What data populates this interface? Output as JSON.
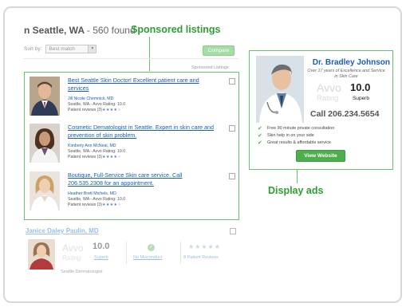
{
  "header": {
    "location": "n Seattle, WA",
    "count": "- 560 found"
  },
  "callouts": {
    "sponsored": "Sponsored listings",
    "display": "Display ads"
  },
  "sort": {
    "label": "Sort by:",
    "value": "Best match"
  },
  "compare_label": "Compare",
  "sponsored_tag": "Sponsored Listings",
  "listings": [
    {
      "title": "Best Seattle Skin Doctor! Excellent patient care and services",
      "name": "Jill Nicole Chemnick, MD",
      "location_rating": "Seattle, WA - Avvo Rating: 10.0",
      "reviews": "Patient reviews (3)",
      "stars_filled": 4
    },
    {
      "title": "Cosmetic Dematologist in Seattle. Expert in skin care and prevention of skin problem.",
      "name": "Kimberly Ann McNeal, MD",
      "location_rating": "Seattle, WA - Avvo Rating: 10.0",
      "reviews": "Patient reviews (3)",
      "stars_filled": 4
    },
    {
      "title": "Boutique, Full-Service Skin care service. Call 206.535.2308 for an appointment.",
      "name": "Heather Brett Michels, MD",
      "location_rating": "Seattle, WA - Avvo Rating: 10.0",
      "reviews": "Patient reviews (3)",
      "stars_filled": 4
    }
  ],
  "organic": {
    "name": "Janice Daley Paulin, MD",
    "avvo": "Avvo",
    "score": "10.0",
    "rating_word": "Rating",
    "superb": "Superb",
    "no_misconduct": "No Misconduct",
    "reviews": "8 Patient Reviews",
    "specialty": "Seattle Dermatologist"
  },
  "ad": {
    "name": "Dr. Bradley Johnson",
    "tagline": "Over 17 years of Excellence and Service in Skin Care",
    "avvo": "Avvo",
    "score": "10.0",
    "rating_word": "Rating",
    "superb": "Superb",
    "phone": "Call 206.234.5654",
    "features": [
      "Free 90 minute private consultation",
      "Skin help in on your side",
      "Great results & affordable service"
    ],
    "button": "View Website"
  },
  "colors": {
    "accent_green": "#2e9e34",
    "link_blue": "#1a5db5",
    "button_green": "#4cae4c"
  }
}
